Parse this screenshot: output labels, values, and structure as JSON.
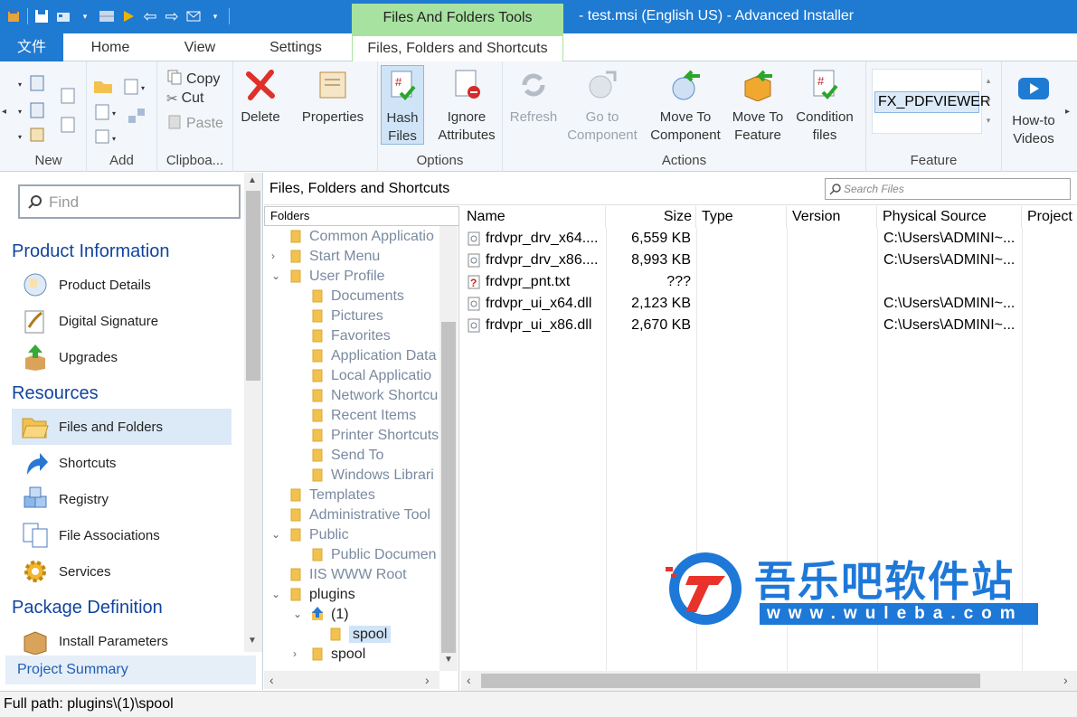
{
  "window": {
    "context_tab": "Files And Folders Tools",
    "title": "- test.msi (English US) - Advanced Installer"
  },
  "tabs": [
    {
      "label": "文件"
    },
    {
      "label": "Home"
    },
    {
      "label": "View"
    },
    {
      "label": "Settings"
    },
    {
      "label": "Files, Folders and Shortcuts"
    }
  ],
  "ribbon": {
    "groups": {
      "new": "New",
      "add": "Add",
      "clipboard": "Clipboa...",
      "options": "Options",
      "actions": "Actions",
      "feature": "Feature"
    },
    "copy": "Copy",
    "cut": "Cut",
    "paste": "Paste",
    "delete": "Delete",
    "properties": "Properties",
    "hash_files_1": "Hash",
    "hash_files_2": "Files",
    "ignore_attr_1": "Ignore",
    "ignore_attr_2": "Attributes",
    "refresh": "Refresh",
    "goto_comp_1": "Go to",
    "goto_comp_2": "Component",
    "move_comp_1": "Move To",
    "move_comp_2": "Component",
    "move_feat_1": "Move To",
    "move_feat_2": "Feature",
    "cond_1": "Condition",
    "cond_2": "files",
    "feature_value": "FX_PDFVIEWER",
    "howto_1": "How-to",
    "howto_2": "Videos"
  },
  "left": {
    "find_placeholder": "Find",
    "sections": [
      {
        "title": "Product Information"
      },
      {
        "title": "Resources"
      },
      {
        "title": "Package Definition"
      }
    ],
    "items": [
      {
        "label": "Product Details",
        "icon": "product-details-icon"
      },
      {
        "label": "Digital Signature",
        "icon": "signature-icon"
      },
      {
        "label": "Upgrades",
        "icon": "upgrades-icon"
      },
      {
        "label": "Files and Folders",
        "icon": "folder-open-icon"
      },
      {
        "label": "Shortcuts",
        "icon": "shortcut-arrow-icon"
      },
      {
        "label": "Registry",
        "icon": "registry-cubes-icon"
      },
      {
        "label": "File Associations",
        "icon": "file-assoc-icon"
      },
      {
        "label": "Services",
        "icon": "gear-icon"
      },
      {
        "label": "Install Parameters",
        "icon": "box-icon"
      }
    ],
    "project_summary": "Project Summary"
  },
  "main": {
    "title": "Files, Folders and Shortcuts",
    "search_placeholder": "Search Files",
    "folders_header": "Folders",
    "tree": [
      {
        "label": "Common Applicatio"
      },
      {
        "label": "Start Menu"
      },
      {
        "label": "User Profile"
      },
      {
        "label": "Documents"
      },
      {
        "label": "Pictures"
      },
      {
        "label": "Favorites"
      },
      {
        "label": "Application Data"
      },
      {
        "label": "Local Applicatio"
      },
      {
        "label": "Network Shortcu"
      },
      {
        "label": "Recent Items"
      },
      {
        "label": "Printer Shortcuts"
      },
      {
        "label": "Send To"
      },
      {
        "label": "Windows Librari"
      },
      {
        "label": "Templates"
      },
      {
        "label": "Administrative Tool"
      },
      {
        "label": "Public"
      },
      {
        "label": "Public Documen"
      },
      {
        "label": "IIS WWW Root"
      },
      {
        "label": "plugins"
      },
      {
        "label": "(1)"
      },
      {
        "label": "spool"
      },
      {
        "label": "spool"
      }
    ],
    "columns": [
      "Name",
      "Size",
      "Type",
      "Version",
      "Physical Source",
      "Project"
    ],
    "files": [
      {
        "name": "frdvpr_drv_x64....",
        "size": "6,559 KB",
        "source": "C:\\Users\\ADMINI~..."
      },
      {
        "name": "frdvpr_drv_x86....",
        "size": "8,993 KB",
        "source": "C:\\Users\\ADMINI~..."
      },
      {
        "name": "frdvpr_pnt.txt",
        "size": "???",
        "source": ""
      },
      {
        "name": "frdvpr_ui_x64.dll",
        "size": "2,123 KB",
        "source": "C:\\Users\\ADMINI~..."
      },
      {
        "name": "frdvpr_ui_x86.dll",
        "size": "2,670 KB",
        "source": "C:\\Users\\ADMINI~..."
      }
    ]
  },
  "status": "Full path: plugins\\(1)\\spool",
  "watermark": {
    "cn": "吾乐吧软件站",
    "url": "www.wuleba.com"
  },
  "colors": {
    "accent": "#1f7ad1",
    "context_tab": "#a8e2a0",
    "section_title": "#12449e"
  }
}
